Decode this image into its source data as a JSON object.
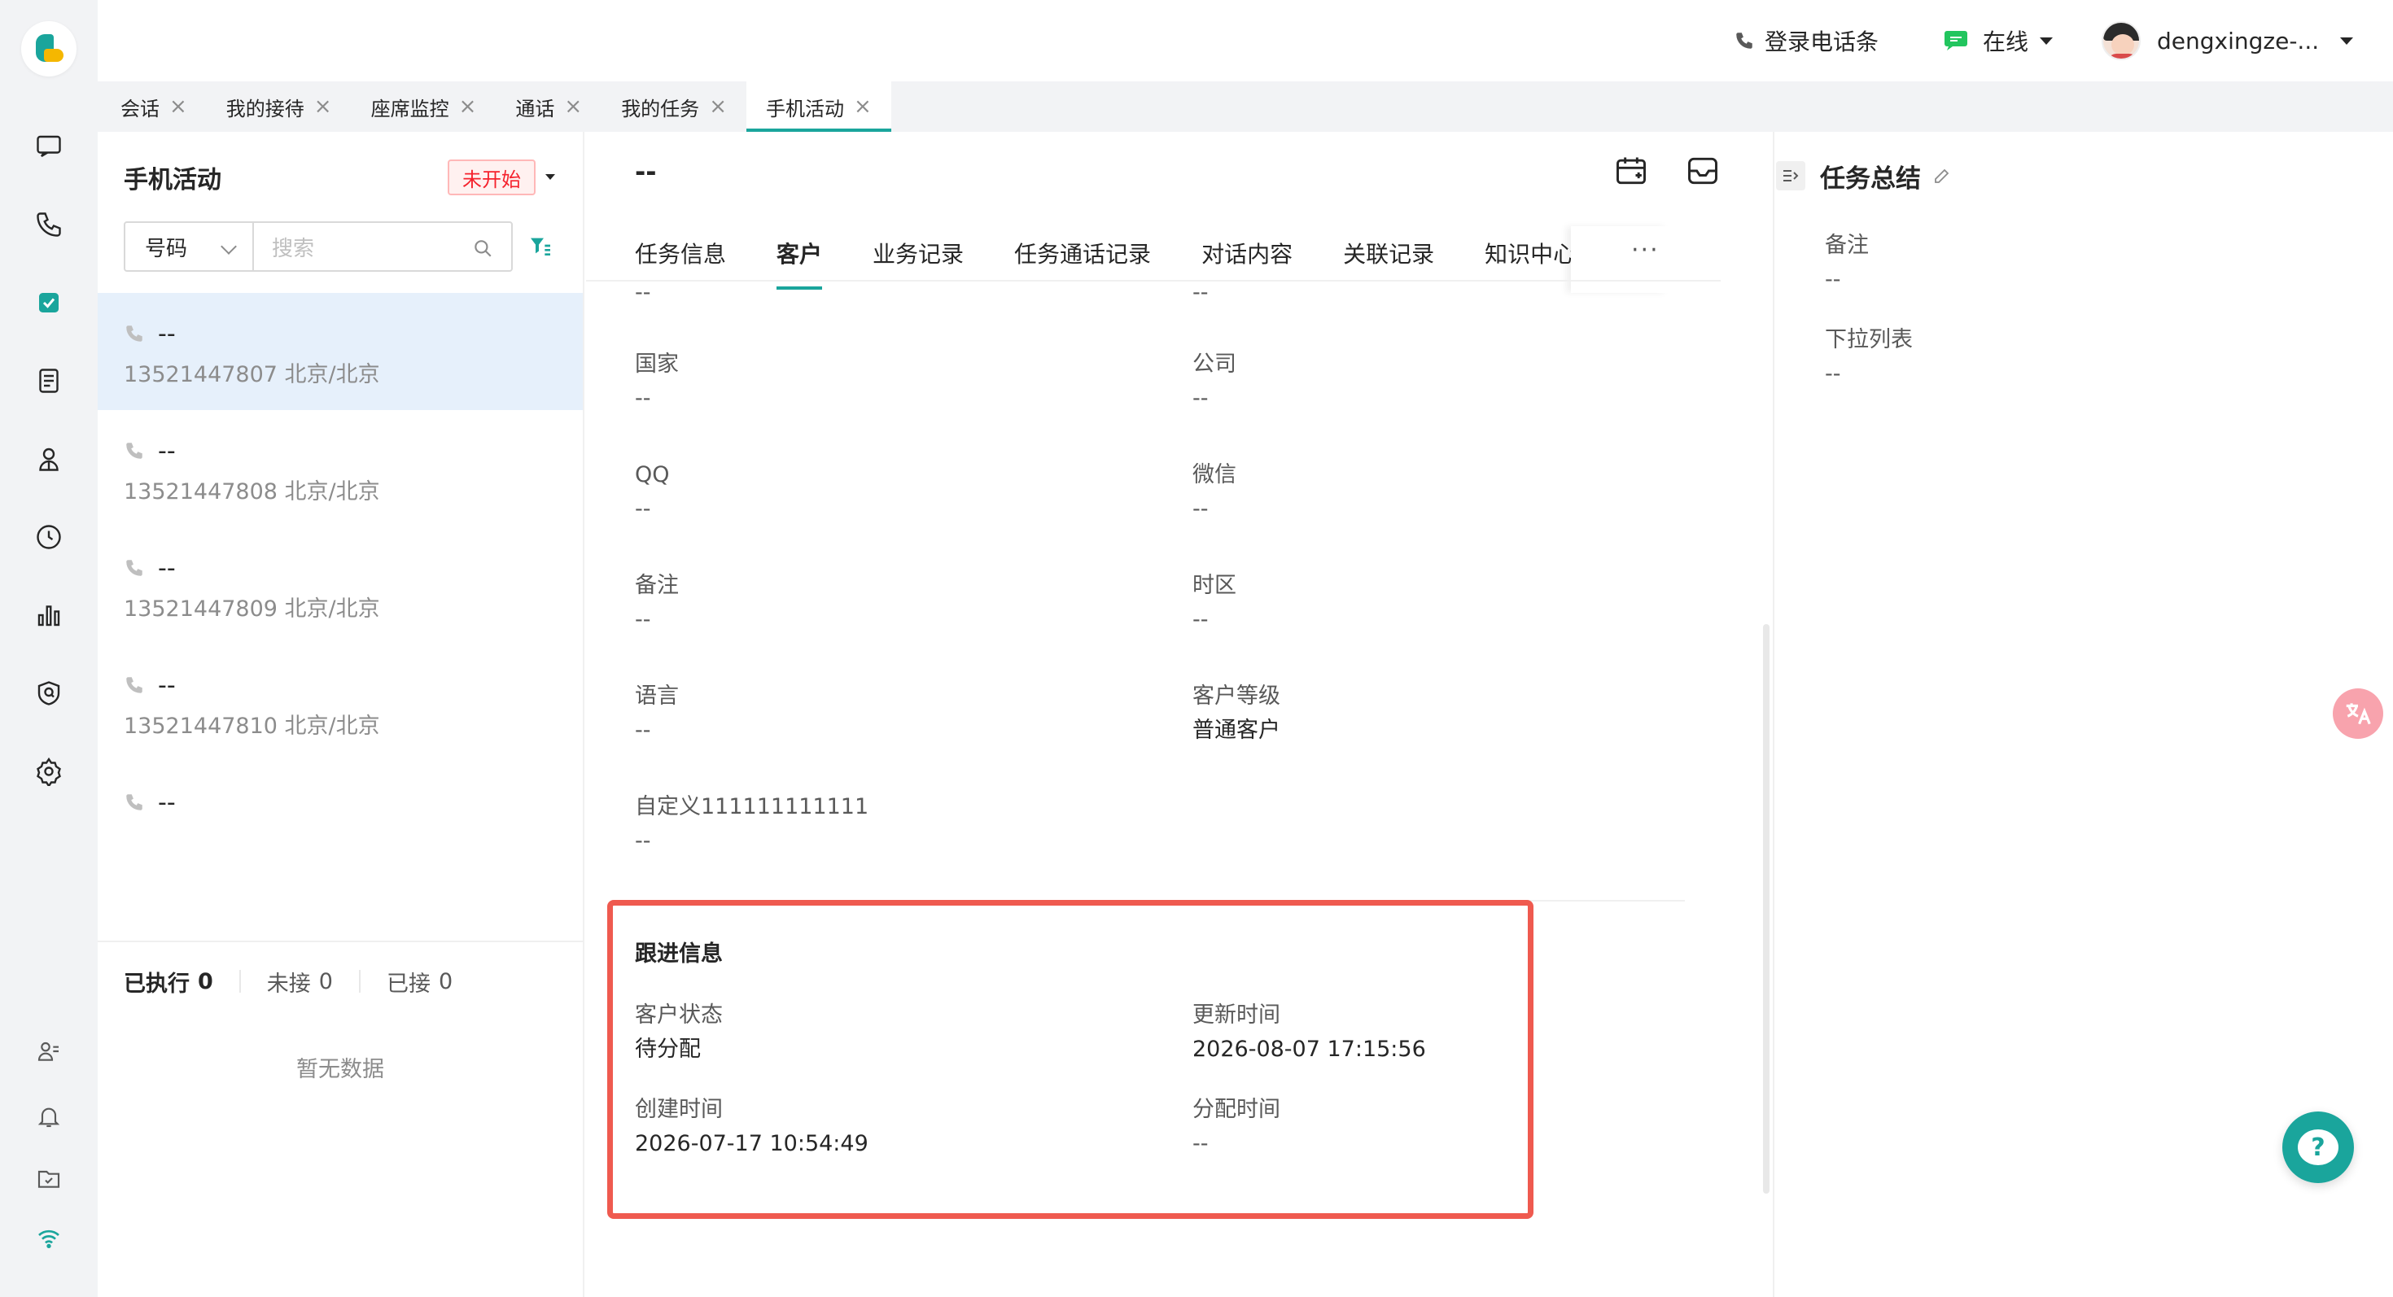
{
  "colors": {
    "accent": "#1aa59c",
    "highlight": "#ef5a4f",
    "badge_red": "#f5222d",
    "selected_row": "#e6f0fb"
  },
  "topbar": {
    "phone_login": "登录电话条",
    "status": "在线",
    "username": "dengxingze-..."
  },
  "tabs": [
    {
      "label": "会话",
      "active": false
    },
    {
      "label": "我的接待",
      "active": false
    },
    {
      "label": "座席监控",
      "active": false
    },
    {
      "label": "通话",
      "active": false
    },
    {
      "label": "我的任务",
      "active": false
    },
    {
      "label": "手机活动",
      "active": true
    }
  ],
  "list": {
    "title": "手机活动",
    "badge": "未开始",
    "search_select": "号码",
    "search_placeholder": "搜索",
    "items": [
      {
        "name": "--",
        "number": "13521447807 北京/北京",
        "selected": true
      },
      {
        "name": "--",
        "number": "13521447808 北京/北京",
        "selected": false
      },
      {
        "name": "--",
        "number": "13521447809 北京/北京",
        "selected": false
      },
      {
        "name": "--",
        "number": "13521447810 北京/北京",
        "selected": false
      },
      {
        "name": "--",
        "number": "",
        "selected": false
      }
    ],
    "stats": [
      {
        "label": "已执行",
        "value": "0"
      },
      {
        "label": "未接",
        "value": "0"
      },
      {
        "label": "已接",
        "value": "0"
      }
    ],
    "empty": "暂无数据"
  },
  "detail": {
    "title": "--",
    "subtabs": [
      "任务信息",
      "客户",
      "业务记录",
      "任务通话记录",
      "对话内容",
      "关联记录",
      "知识中心"
    ],
    "active_subtab": "客户",
    "more": "···",
    "top_values": [
      "--",
      "--"
    ],
    "fields": [
      {
        "label": "国家",
        "value": "--"
      },
      {
        "label": "公司",
        "value": "--"
      },
      {
        "label": "QQ",
        "value": "--"
      },
      {
        "label": "微信",
        "value": "--"
      },
      {
        "label": "备注",
        "value": "--"
      },
      {
        "label": "时区",
        "value": "--"
      },
      {
        "label": "语言",
        "value": "--"
      },
      {
        "label": "客户等级",
        "value": "普通客户"
      },
      {
        "label": "自定义111111111111",
        "value": "--"
      }
    ],
    "followup": {
      "title": "跟进信息",
      "fields": [
        {
          "label": "客户状态",
          "value": "待分配"
        },
        {
          "label": "更新时间",
          "value": "2026-08-07 17:15:56"
        },
        {
          "label": "创建时间",
          "value": "2026-07-17 10:54:49"
        },
        {
          "label": "分配时间",
          "value": "--"
        }
      ]
    }
  },
  "summary": {
    "title": "任务总结",
    "fields": [
      {
        "label": "备注",
        "value": "--"
      },
      {
        "label": "下拉列表",
        "value": "--"
      }
    ]
  },
  "icons": {
    "rail": [
      "chat-icon",
      "phone-icon",
      "task-icon",
      "document-icon",
      "contacts-icon",
      "history-icon",
      "stats-icon",
      "monitor-icon",
      "settings-icon",
      "agent-icon",
      "bell-icon",
      "inbox-icon",
      "wifi-icon"
    ]
  }
}
